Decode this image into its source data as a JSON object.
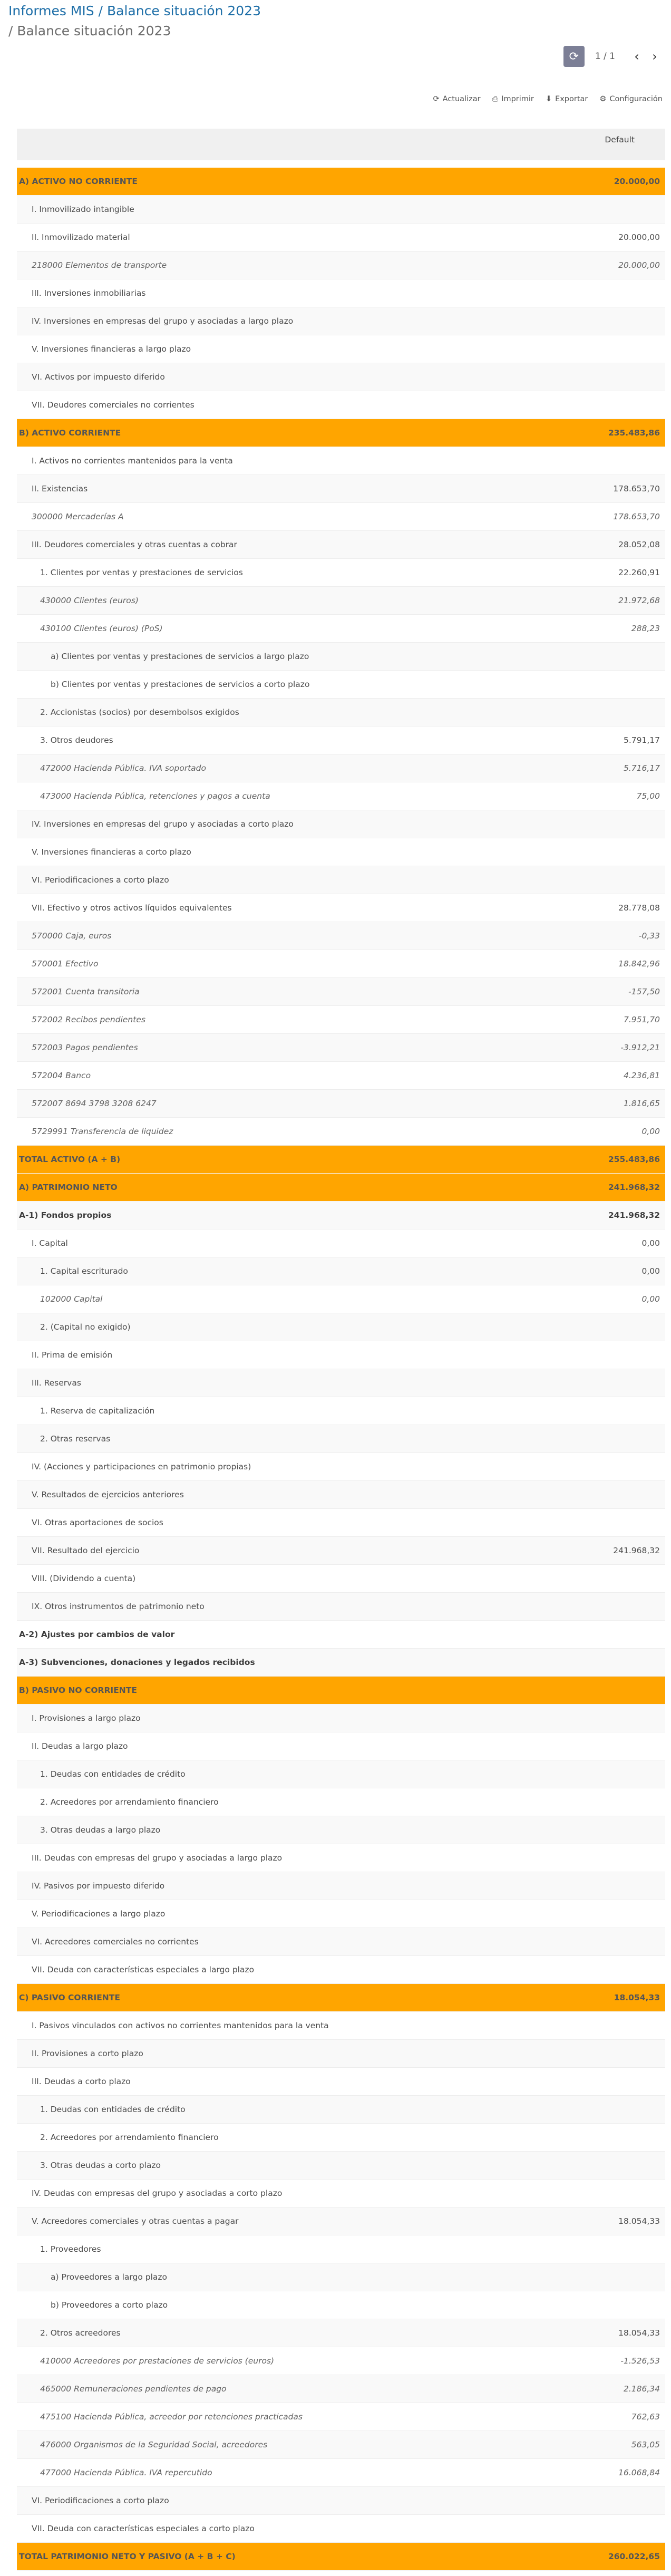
{
  "breadcrumb": {
    "line1": "Informes MIS / Balance situación 2023",
    "line2": "/ Balance situación 2023"
  },
  "pager": {
    "text": "1 / 1"
  },
  "toolbar": {
    "refresh": "Actualizar",
    "print": "Imprimir",
    "export": "Exportar",
    "config": "Configuración"
  },
  "table": {
    "column_header": "Default",
    "rows": [
      {
        "label": "A) ACTIVO NO CORRIENTE",
        "value": "20.000,00",
        "type": "hdr",
        "indent": 0
      },
      {
        "label": "I. Inmovilizado intangible",
        "value": "",
        "type": "normal",
        "indent": 1
      },
      {
        "label": "II. Inmovilizado material",
        "value": "20.000,00",
        "type": "normal",
        "indent": 1
      },
      {
        "label": "218000 Elementos de transporte",
        "value": "20.000,00",
        "type": "acct",
        "indent": 1
      },
      {
        "label": "III. Inversiones inmobiliarias",
        "value": "",
        "type": "normal",
        "indent": 1
      },
      {
        "label": "IV. Inversiones en empresas del grupo y asociadas a largo plazo",
        "value": "",
        "type": "normal",
        "indent": 1
      },
      {
        "label": "V. Inversiones financieras a largo plazo",
        "value": "",
        "type": "normal",
        "indent": 1
      },
      {
        "label": "VI. Activos por impuesto diferido",
        "value": "",
        "type": "normal",
        "indent": 1
      },
      {
        "label": "VII. Deudores comerciales no corrientes",
        "value": "",
        "type": "normal",
        "indent": 1
      },
      {
        "label": "B) ACTIVO CORRIENTE",
        "value": "235.483,86",
        "type": "hdr",
        "indent": 0
      },
      {
        "label": "I. Activos no corrientes mantenidos para la venta",
        "value": "",
        "type": "normal",
        "indent": 1
      },
      {
        "label": "II. Existencias",
        "value": "178.653,70",
        "type": "normal",
        "indent": 1
      },
      {
        "label": "300000 Mercaderías A",
        "value": "178.653,70",
        "type": "acct",
        "indent": 1
      },
      {
        "label": "III. Deudores comerciales y otras cuentas a cobrar",
        "value": "28.052,08",
        "type": "normal",
        "indent": 1
      },
      {
        "label": "1. Clientes por ventas y prestaciones de servicios",
        "value": "22.260,91",
        "type": "normal",
        "indent": 2
      },
      {
        "label": "430000 Clientes (euros)",
        "value": "21.972,68",
        "type": "acct",
        "indent": 2
      },
      {
        "label": "430100 Clientes (euros) (PoS)",
        "value": "288,23",
        "type": "acct",
        "indent": 2
      },
      {
        "label": "a) Clientes por ventas y prestaciones de servicios a largo plazo",
        "value": "",
        "type": "normal",
        "indent": 3
      },
      {
        "label": "b) Clientes por ventas y prestaciones de servicios a corto plazo",
        "value": "",
        "type": "normal",
        "indent": 3
      },
      {
        "label": "2. Accionistas (socios) por desembolsos exigidos",
        "value": "",
        "type": "normal",
        "indent": 2
      },
      {
        "label": "3. Otros deudores",
        "value": "5.791,17",
        "type": "normal",
        "indent": 2
      },
      {
        "label": "472000 Hacienda Pública. IVA soportado",
        "value": "5.716,17",
        "type": "acct",
        "indent": 2
      },
      {
        "label": "473000 Hacienda Pública, retenciones y pagos a cuenta",
        "value": "75,00",
        "type": "acct",
        "indent": 2
      },
      {
        "label": "IV. Inversiones en empresas del grupo y asociadas a corto plazo",
        "value": "",
        "type": "normal",
        "indent": 1
      },
      {
        "label": "V. Inversiones financieras a corto plazo",
        "value": "",
        "type": "normal",
        "indent": 1
      },
      {
        "label": "VI. Periodificaciones a corto plazo",
        "value": "",
        "type": "normal",
        "indent": 1
      },
      {
        "label": "VII. Efectivo y otros activos líquidos equivalentes",
        "value": "28.778,08",
        "type": "normal",
        "indent": 1
      },
      {
        "label": "570000 Caja, euros",
        "value": "-0,33",
        "type": "acct",
        "indent": 1
      },
      {
        "label": "570001 Efectivo",
        "value": "18.842,96",
        "type": "acct",
        "indent": 1
      },
      {
        "label": "572001 Cuenta transitoria",
        "value": "-157,50",
        "type": "acct",
        "indent": 1
      },
      {
        "label": "572002 Recibos pendientes",
        "value": "7.951,70",
        "type": "acct",
        "indent": 1
      },
      {
        "label": "572003 Pagos pendientes",
        "value": "-3.912,21",
        "type": "acct",
        "indent": 1
      },
      {
        "label": "572004 Banco",
        "value": "4.236,81",
        "type": "acct",
        "indent": 1
      },
      {
        "label": "572007 8694 3798 3208 6247",
        "value": "1.816,65",
        "type": "acct",
        "indent": 1
      },
      {
        "label": "5729991 Transferencia de liquidez",
        "value": "0,00",
        "type": "acct",
        "indent": 1
      },
      {
        "label": "TOTAL ACTIVO (A + B)",
        "value": "255.483,86",
        "type": "hdr",
        "indent": 0
      },
      {
        "label": "A) PATRIMONIO NETO",
        "value": "241.968,32",
        "type": "hdr",
        "indent": 0
      },
      {
        "label": "A-1) Fondos propios",
        "value": "241.968,32",
        "type": "bold",
        "indent": 0
      },
      {
        "label": "I. Capital",
        "value": "0,00",
        "type": "normal",
        "indent": 1
      },
      {
        "label": "1. Capital escriturado",
        "value": "0,00",
        "type": "normal",
        "indent": 2
      },
      {
        "label": "102000 Capital",
        "value": "0,00",
        "type": "acct",
        "indent": 2
      },
      {
        "label": "2. (Capital no exigido)",
        "value": "",
        "type": "normal",
        "indent": 2
      },
      {
        "label": "II. Prima de emisión",
        "value": "",
        "type": "normal",
        "indent": 1
      },
      {
        "label": "III. Reservas",
        "value": "",
        "type": "normal",
        "indent": 1
      },
      {
        "label": "1. Reserva de capitalización",
        "value": "",
        "type": "normal",
        "indent": 2
      },
      {
        "label": "2. Otras reservas",
        "value": "",
        "type": "normal",
        "indent": 2
      },
      {
        "label": "IV. (Acciones y participaciones en patrimonio propias)",
        "value": "",
        "type": "normal",
        "indent": 1
      },
      {
        "label": "V. Resultados de ejercicios anteriores",
        "value": "",
        "type": "normal",
        "indent": 1
      },
      {
        "label": "VI. Otras aportaciones de socios",
        "value": "",
        "type": "normal",
        "indent": 1
      },
      {
        "label": "VII. Resultado del ejercicio",
        "value": "241.968,32",
        "type": "normal",
        "indent": 1
      },
      {
        "label": "VIII. (Dividendo a cuenta)",
        "value": "",
        "type": "normal",
        "indent": 1
      },
      {
        "label": "IX. Otros instrumentos de patrimonio neto",
        "value": "",
        "type": "normal",
        "indent": 1
      },
      {
        "label": "A-2) Ajustes por cambios de valor",
        "value": "",
        "type": "bold",
        "indent": 0
      },
      {
        "label": "A-3) Subvenciones, donaciones y legados recibidos",
        "value": "",
        "type": "bold",
        "indent": 0
      },
      {
        "label": "B) PASIVO NO CORRIENTE",
        "value": "",
        "type": "hdr",
        "indent": 0
      },
      {
        "label": "I. Provisiones a largo plazo",
        "value": "",
        "type": "normal",
        "indent": 1
      },
      {
        "label": "II. Deudas a largo plazo",
        "value": "",
        "type": "normal",
        "indent": 1
      },
      {
        "label": "1. Deudas con entidades de crédito",
        "value": "",
        "type": "normal",
        "indent": 2
      },
      {
        "label": "2. Acreedores por arrendamiento financiero",
        "value": "",
        "type": "normal",
        "indent": 2
      },
      {
        "label": "3. Otras deudas a largo plazo",
        "value": "",
        "type": "normal",
        "indent": 2
      },
      {
        "label": "III. Deudas con empresas del grupo y asociadas a largo plazo",
        "value": "",
        "type": "normal",
        "indent": 1
      },
      {
        "label": "IV. Pasivos por impuesto diferido",
        "value": "",
        "type": "normal",
        "indent": 1
      },
      {
        "label": "V. Periodificaciones a largo plazo",
        "value": "",
        "type": "normal",
        "indent": 1
      },
      {
        "label": "VI. Acreedores comerciales no corrientes",
        "value": "",
        "type": "normal",
        "indent": 1
      },
      {
        "label": "VII. Deuda con características especiales a largo plazo",
        "value": "",
        "type": "normal",
        "indent": 1
      },
      {
        "label": "C) PASIVO CORRIENTE",
        "value": "18.054,33",
        "type": "hdr",
        "indent": 0
      },
      {
        "label": "I. Pasivos vinculados con activos no corrientes mantenidos para la venta",
        "value": "",
        "type": "normal",
        "indent": 1
      },
      {
        "label": "II. Provisiones a corto plazo",
        "value": "",
        "type": "normal",
        "indent": 1
      },
      {
        "label": "III. Deudas a corto plazo",
        "value": "",
        "type": "normal",
        "indent": 1
      },
      {
        "label": "1. Deudas con entidades de crédito",
        "value": "",
        "type": "normal",
        "indent": 2
      },
      {
        "label": "2. Acreedores por arrendamiento financiero",
        "value": "",
        "type": "normal",
        "indent": 2
      },
      {
        "label": "3. Otras deudas a corto plazo",
        "value": "",
        "type": "normal",
        "indent": 2
      },
      {
        "label": "IV. Deudas con empresas del grupo y asociadas a corto plazo",
        "value": "",
        "type": "normal",
        "indent": 1
      },
      {
        "label": "V. Acreedores comerciales y otras cuentas a pagar",
        "value": "18.054,33",
        "type": "normal",
        "indent": 1
      },
      {
        "label": "1. Proveedores",
        "value": "",
        "type": "normal",
        "indent": 2
      },
      {
        "label": "a) Proveedores a largo plazo",
        "value": "",
        "type": "normal",
        "indent": 3
      },
      {
        "label": "b) Proveedores a corto plazo",
        "value": "",
        "type": "normal",
        "indent": 3
      },
      {
        "label": "2. Otros acreedores",
        "value": "18.054,33",
        "type": "normal",
        "indent": 2
      },
      {
        "label": "410000 Acreedores por prestaciones de servicios (euros)",
        "value": "-1.526,53",
        "type": "acct",
        "indent": 2
      },
      {
        "label": "465000 Remuneraciones pendientes de pago",
        "value": "2.186,34",
        "type": "acct",
        "indent": 2
      },
      {
        "label": "475100 Hacienda Pública, acreedor por retenciones practicadas",
        "value": "762,63",
        "type": "acct",
        "indent": 2
      },
      {
        "label": "476000 Organismos de la Seguridad Social, acreedores",
        "value": "563,05",
        "type": "acct",
        "indent": 2
      },
      {
        "label": "477000 Hacienda Pública. IVA repercutido",
        "value": "16.068,84",
        "type": "acct",
        "indent": 2
      },
      {
        "label": "VI. Periodificaciones a corto plazo",
        "value": "",
        "type": "normal",
        "indent": 1
      },
      {
        "label": "VII. Deuda con características especiales a corto plazo",
        "value": "",
        "type": "normal",
        "indent": 1
      },
      {
        "label": "TOTAL PATRIMONIO NETO Y PASIVO (A + B + C)",
        "value": "260.022,65",
        "type": "hdr",
        "indent": 0
      }
    ]
  }
}
